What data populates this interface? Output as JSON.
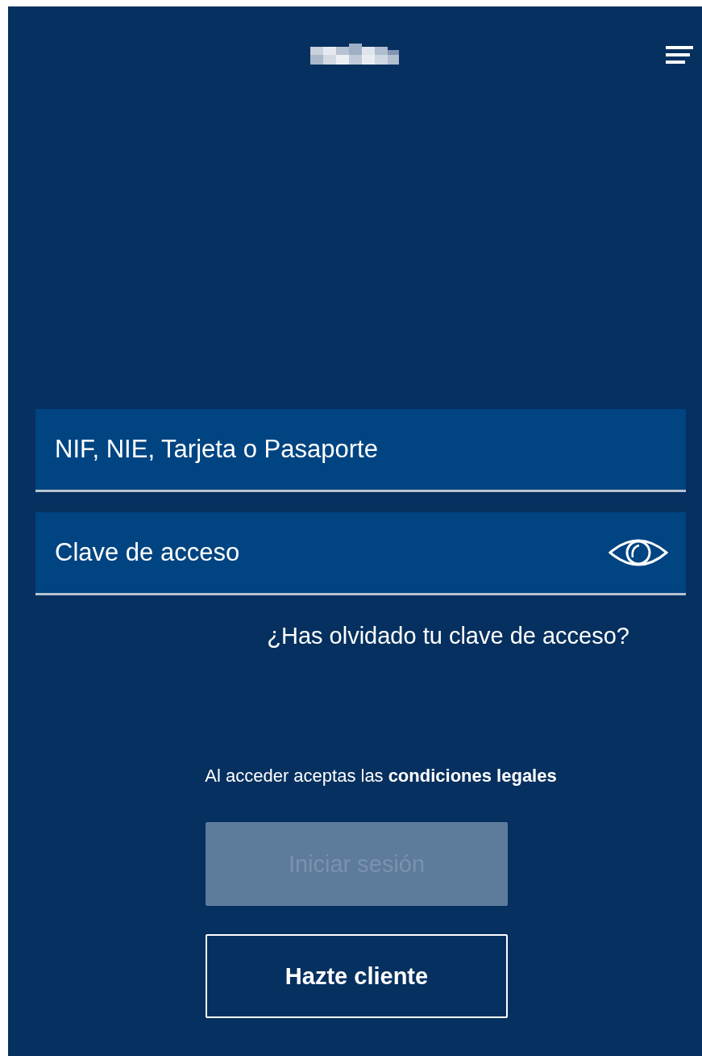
{
  "header": {
    "logo": {
      "kind": "pixelated"
    },
    "menu": true
  },
  "fields": [
    {
      "kind": "text",
      "placeholder": "NIF, NIE, Tarjeta o Pasaporte"
    },
    {
      "kind": "password",
      "placeholder": "Clave de acceso"
    }
  ],
  "forgot_link": "¿Has olvidado tu clave de acceso?",
  "legal": {
    "text": "Al acceder aceptas las",
    "link": "condiciones legales"
  },
  "buttons": [
    {
      "kind": "filled",
      "label": "Iniciar sesión",
      "disabled": true
    },
    {
      "kind": "outline",
      "label": "Hazte cliente",
      "disabled": false
    }
  ]
}
